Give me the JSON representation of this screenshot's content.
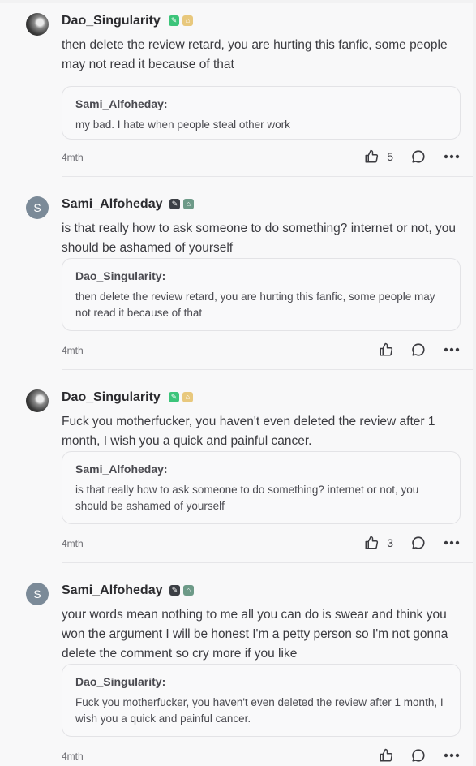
{
  "comments": [
    {
      "username": "Dao_Singularity",
      "avatar": "photo",
      "badges": [
        "writer-badge-icon",
        "lock-badge-icon"
      ],
      "text": "then delete the review retard, you are hurting this fanfic, some people may not read it because of that",
      "quote": {
        "username": "Sami_Alfoheday:",
        "text": "my bad. I hate when people steal other work"
      },
      "time": "4mth",
      "likes": "5"
    },
    {
      "username": "Sami_Alfoheday",
      "avatar_letter": "S",
      "badges": [
        "writer-badge-icon",
        "lock-badge-icon"
      ],
      "text": "is that really how to ask someone to do something? internet or not, you should be ashamed of yourself",
      "quote": {
        "username": "Dao_Singularity:",
        "text": "then delete the review retard, you are hurting this fanfic, some people may not read it because of that"
      },
      "time": "4mth",
      "likes": ""
    },
    {
      "username": "Dao_Singularity",
      "avatar": "photo",
      "badges": [
        "writer-badge-icon",
        "lock-badge-icon"
      ],
      "text": "Fuck you motherfucker, you haven't even deleted the review after 1 month, I wish you a quick and painful cancer.",
      "quote": {
        "username": "Sami_Alfoheday:",
        "text": "is that really how to ask someone to do something? internet or not, you should be ashamed of yourself"
      },
      "time": "4mth",
      "likes": "3"
    },
    {
      "username": "Sami_Alfoheday",
      "avatar_letter": "S",
      "badges": [
        "writer-badge-icon",
        "lock-badge-icon"
      ],
      "text": "your words mean nothing to me all you can do is swear and think you won the argument I will be honest I'm a petty person so I'm not gonna delete the comment so cry more if you like",
      "quote": {
        "username": "Dao_Singularity:",
        "text": "Fuck you motherfucker, you haven't even deleted the review after 1 month, I wish you a quick and painful cancer."
      },
      "time": "4mth",
      "likes": ""
    }
  ],
  "colors": {
    "badge_green": "#3cc47a",
    "badge_gold": "#e8c87d",
    "badge_teal": "#6d9a88",
    "avatar_letter_bg": "#7b8a98"
  }
}
